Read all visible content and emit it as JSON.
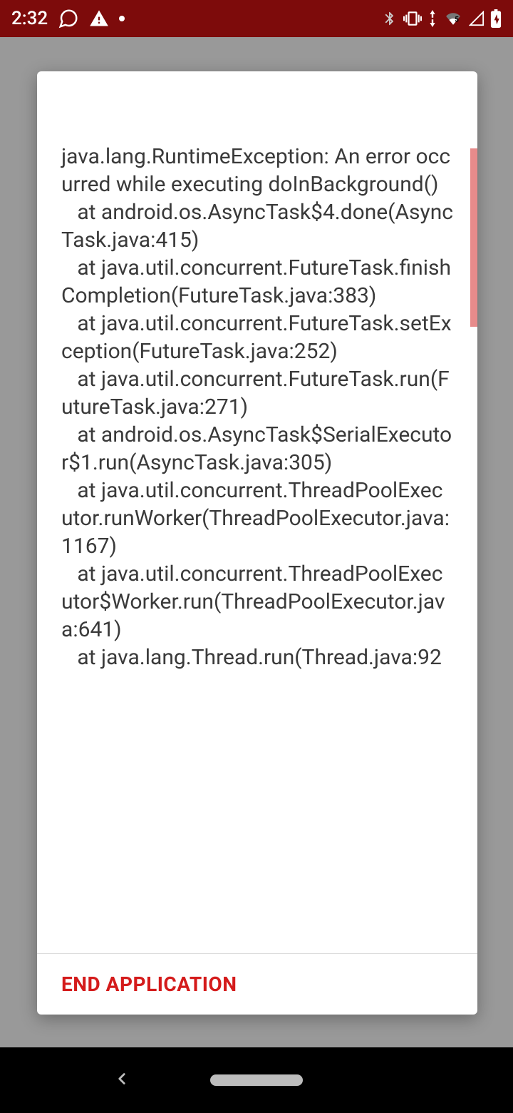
{
  "status": {
    "time": "2:32"
  },
  "dialog": {
    "stacktrace": "java.lang.RuntimeException: An error occurred while executing doInBackground()\n   at android.os.AsyncTask$4.done(AsyncTask.java:415)\n   at java.util.concurrent.FutureTask.finishCompletion(FutureTask.java:383)\n   at java.util.concurrent.FutureTask.setException(FutureTask.java:252)\n   at java.util.concurrent.FutureTask.run(FutureTask.java:271)\n   at android.os.AsyncTask$SerialExecutor$1.run(AsyncTask.java:305)\n   at java.util.concurrent.ThreadPoolExecutor.runWorker(ThreadPoolExecutor.java:1167)\n   at java.util.concurrent.ThreadPoolExecutor$Worker.run(ThreadPoolExecutor.java:641)\n   at java.lang.Thread.run(Thread.java:92",
    "end_label": "END APPLICATION"
  }
}
